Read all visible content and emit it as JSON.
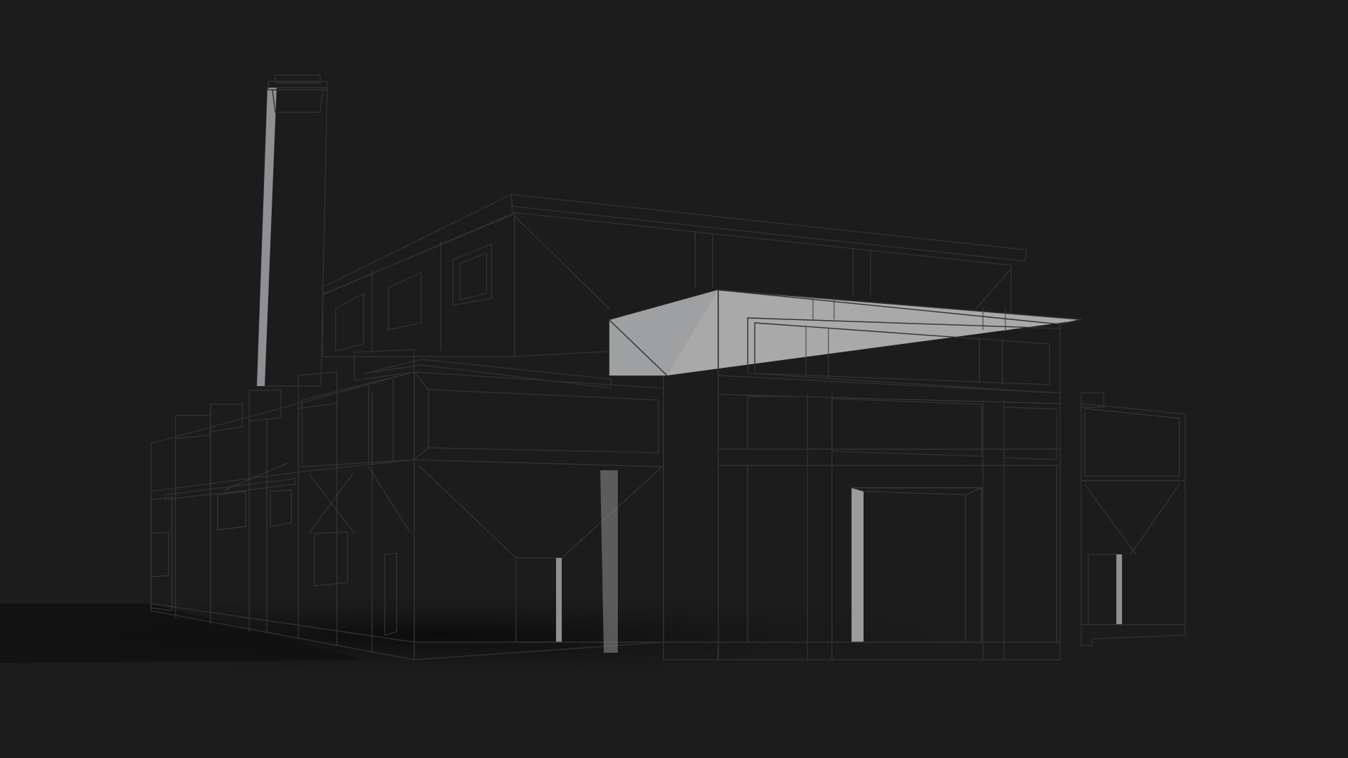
{
  "scene": {
    "subject": "factory-building-clay-render",
    "background_color": "#1c1c1c",
    "ground_shadow_color": "#0e0e0e",
    "clay_light": "#b4b4b2",
    "clay_mid": "#a4a4a2",
    "clay_shade": "#8d8f91",
    "clay_dark": "#7d8084",
    "edge_color": "#2e3032"
  }
}
